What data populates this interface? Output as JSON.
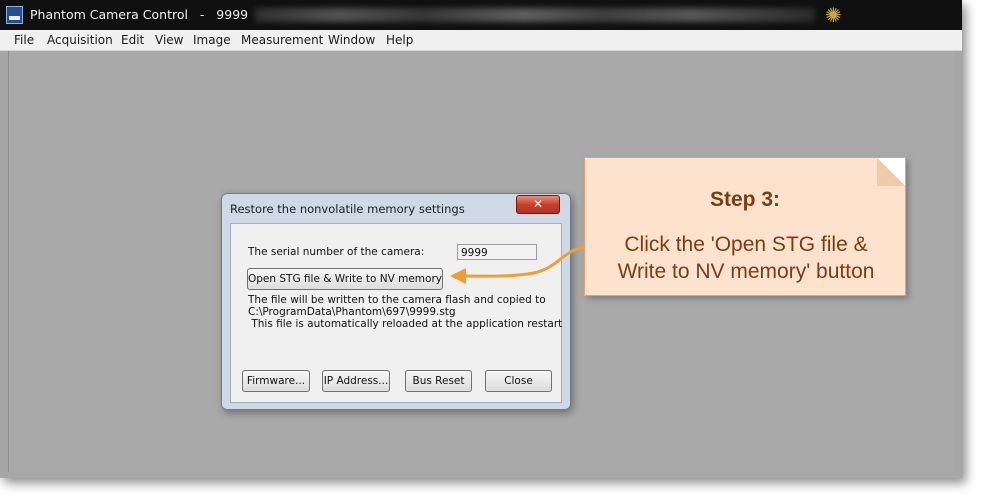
{
  "window": {
    "title": "Phantom Camera Control   -   9999"
  },
  "menu": [
    "File",
    "Acquisition",
    "Edit",
    "View",
    "Image",
    "Measurement",
    "Window",
    "Help"
  ],
  "dialog": {
    "title": "Restore the nonvolatile memory settings",
    "close_label": "✕",
    "serial_label": "The serial number of the camera:",
    "serial_value": "9999",
    "open_button": "Open STG file & Write to NV memory",
    "info_line1": "The file will be written to the camera flash and copied to",
    "info_line2": "C:\\ProgramData\\Phantom\\697\\9999.stg",
    "info_line3": " This file is automatically reloaded at the application restart",
    "buttons": {
      "firmware": "Firmware...",
      "ip_address": "IP Address...",
      "bus_reset": "Bus Reset",
      "close": "Close"
    }
  },
  "callout": {
    "title": "Step 3:",
    "text_line1": "Click the 'Open STG file &",
    "text_line2": "Write to NV memory' button"
  },
  "colors": {
    "arrow": "#f0a030",
    "callout_bg": "#fde3ce",
    "callout_text": "#7a3d12"
  }
}
